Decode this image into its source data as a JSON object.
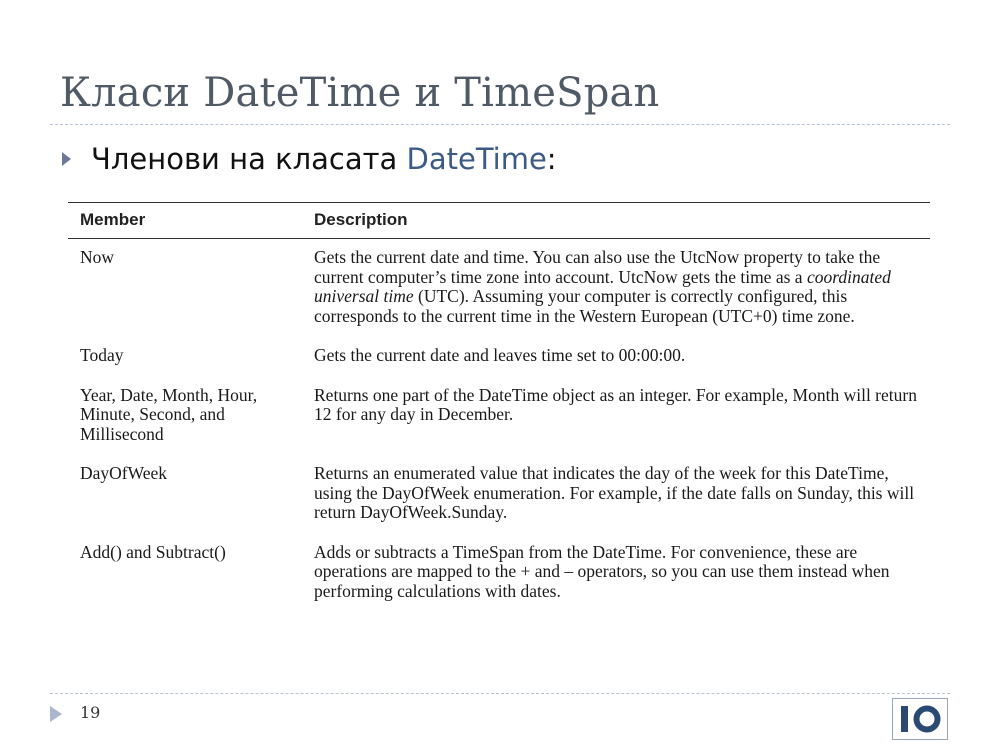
{
  "slide": {
    "title": "Класи DateTime и TimeSpan",
    "bullet": {
      "prefix": "Членови на класата ",
      "accent": "DateTime",
      "suffix": ":"
    },
    "page_number": "19",
    "logo_text": "IO"
  },
  "table": {
    "headers": [
      "Member",
      "Description"
    ],
    "rows": [
      {
        "member": "Now",
        "desc_before": "Gets the current date and time. You can also use the UtcNow property to take the current computer’s time zone into account. UtcNow gets the time as a ",
        "desc_italic": "coordinated universal time",
        "desc_after": " (UTC). Assuming your computer is correctly configured, this corresponds to the current time in the Western European (UTC+0) time zone."
      },
      {
        "member": "Today",
        "desc_before": "Gets the current date and leaves time set to 00:00:00.",
        "desc_italic": "",
        "desc_after": ""
      },
      {
        "member": "Year, Date, Month, Hour, Minute, Second, and Millisecond",
        "desc_before": "Returns one part of the DateTime object as an integer. For example, Month will return 12 for any day in December.",
        "desc_italic": "",
        "desc_after": ""
      },
      {
        "member": "DayOfWeek",
        "desc_before": "Returns an enumerated value that indicates the day of the week for this DateTime, using the DayOfWeek enumeration. For example, if the date falls on Sunday, this will return DayOfWeek.Sunday.",
        "desc_italic": "",
        "desc_after": ""
      },
      {
        "member": "Add() and Subtract()",
        "desc_before": "Adds or subtracts a TimeSpan from the DateTime. For convenience, these are operations are mapped to the + and – operators, so you can use them instead when performing calculations with dates.",
        "desc_italic": "",
        "desc_after": ""
      }
    ]
  },
  "colors": {
    "title": "#4f5a66",
    "accent": "#3b5a86",
    "bullet": "#6c7a98",
    "rule": "#b7c3d4"
  },
  "icons": {
    "bullet": "triangle-bullet-icon",
    "footer": "triangle-footer-icon",
    "logo": "io-logo-icon"
  }
}
